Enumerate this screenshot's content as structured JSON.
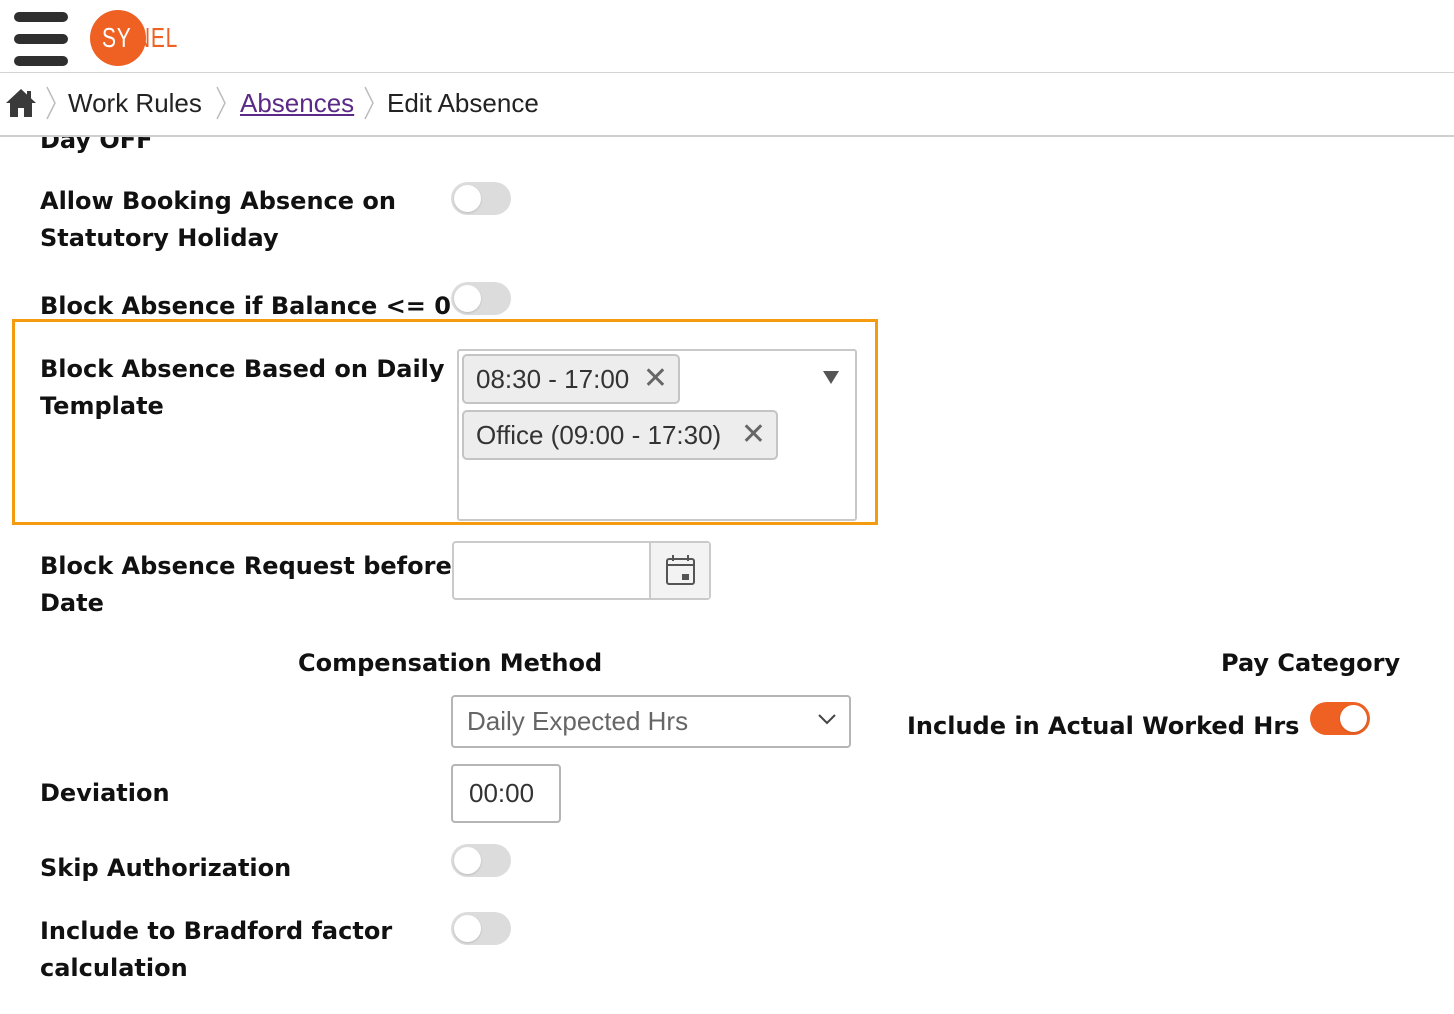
{
  "header": {
    "menu_icon": "hamburger-icon",
    "logo": {
      "part1": "SY",
      "part2": "NEL",
      "brand_color": "#ee6123"
    }
  },
  "breadcrumb": {
    "home_icon": "home-icon",
    "items": [
      "Work Rules",
      "Absences",
      "Edit Absence"
    ]
  },
  "form": {
    "cut_off_label": "Day OFF",
    "allow_statutory": {
      "label_line1": "Allow Booking Absence on",
      "label_line2": "Statutory Holiday",
      "on": false
    },
    "block_balance": {
      "label": "Block Absence if Balance <= 0",
      "on": false
    },
    "block_template": {
      "label_line1": "Block Absence Based on Daily",
      "label_line2": "Template",
      "chips": [
        "08:30 - 17:00",
        "Office (09:00 - 17:30)"
      ],
      "remove_glyph": "✕",
      "highlight_color": "#f59b10"
    },
    "block_before_date": {
      "label_line1": "Block Absence Request before",
      "label_line2": "Date",
      "value": "",
      "icon": "calendar-icon"
    },
    "compensation_heading": "Compensation Method",
    "pay_category_heading": "Pay Category",
    "compensation_select": {
      "value": "Daily Expected Hrs",
      "icon": "chevron-down-icon"
    },
    "include_actual": {
      "label": "Include in Actual Worked Hrs",
      "on": true,
      "on_color": "#ee6123"
    },
    "deviation": {
      "label": "Deviation",
      "value": "00:00"
    },
    "skip_authorization": {
      "label": "Skip Authorization",
      "on": false
    },
    "bradford": {
      "label_line1": "Include to Bradford factor",
      "label_line2": "calculation",
      "on": false
    }
  }
}
